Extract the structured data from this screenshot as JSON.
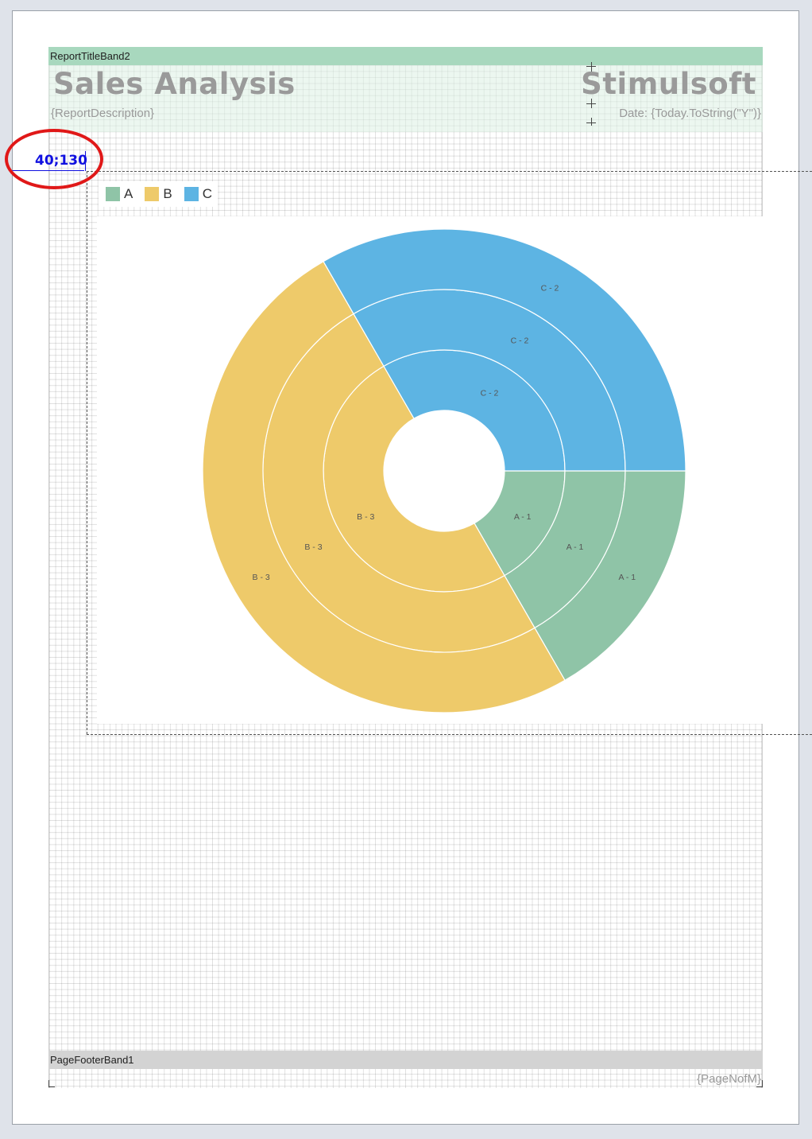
{
  "report": {
    "title_band_name": "ReportTitleBand2",
    "title": "Sales Analysis",
    "company": "Stimulsoft",
    "description": "{ReportDescription}",
    "date_expr": "Date: {Today.ToString(\"Y\")}",
    "footer_band_name": "PageFooterBand1",
    "footer_expr": "{PageNofM}"
  },
  "cursor_coordinates": "40;130",
  "legend": [
    {
      "label": "A",
      "color": "#8fc4a7"
    },
    {
      "label": "B",
      "color": "#eeca6a"
    },
    {
      "label": "C",
      "color": "#5db4e3"
    }
  ],
  "chart_data": {
    "type": "doughnut",
    "rings": 3,
    "categories": [
      "A",
      "B",
      "C"
    ],
    "series": [
      {
        "values": [
          1,
          3,
          2
        ],
        "labels": [
          "A - 1",
          "B - 3",
          "C - 2"
        ]
      },
      {
        "values": [
          1,
          3,
          2
        ],
        "labels": [
          "A - 1",
          "B - 3",
          "C - 2"
        ]
      },
      {
        "values": [
          1,
          3,
          2
        ],
        "labels": [
          "A - 1",
          "B - 3",
          "C - 2"
        ]
      }
    ],
    "colors": [
      "#8fc4a7",
      "#eeca6a",
      "#5db4e3"
    ],
    "legend_position": "top-left"
  }
}
